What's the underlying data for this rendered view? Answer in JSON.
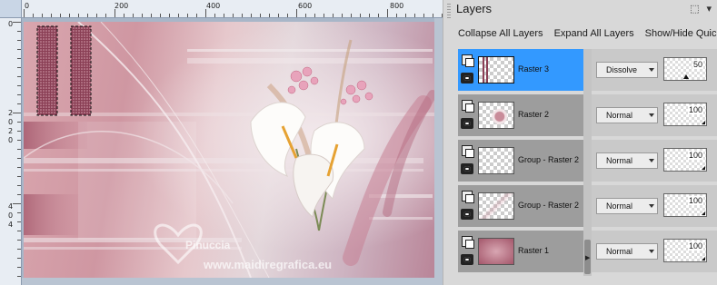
{
  "ruler": {
    "top_labels": [
      "0",
      "200",
      "400",
      "600",
      "800"
    ],
    "left_labels": [
      "0",
      "2",
      "0",
      "2",
      "0",
      "4",
      "0",
      "4"
    ]
  },
  "canvas": {
    "watermark_text": "Pinuccia",
    "watermark_url": "www.maidiregrafica.eu"
  },
  "panel": {
    "title": "Layers",
    "toolbar": [
      "Collapse All Layers",
      "Expand All Layers",
      "Show/Hide Quic"
    ],
    "window_buttons": [
      "pin-icon",
      "dropdown-icon"
    ]
  },
  "layers": [
    {
      "name": "Raster 3",
      "blend": "Dissolve",
      "opacity": "50",
      "selected": true,
      "thumb": "raster3"
    },
    {
      "name": "Raster 2",
      "blend": "Normal",
      "opacity": "100",
      "selected": false,
      "thumb": "flowers"
    },
    {
      "name": "Group - Raster 2",
      "blend": "Normal",
      "opacity": "100",
      "selected": false,
      "thumb": "empty"
    },
    {
      "name": "Group - Raster 2",
      "blend": "Normal",
      "opacity": "100",
      "selected": false,
      "thumb": "faint"
    },
    {
      "name": "Raster 1",
      "blend": "Normal",
      "opacity": "100",
      "selected": false,
      "thumb": "pink"
    }
  ],
  "colors": {
    "selection": "#3399ff",
    "canvas_pink": "#c98c9a",
    "canvas_dark": "#a3566a"
  }
}
